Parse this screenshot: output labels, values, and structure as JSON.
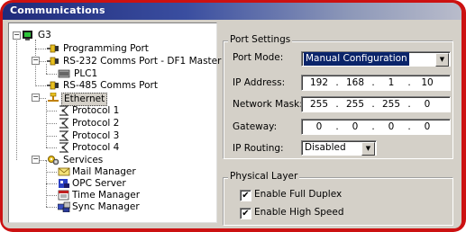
{
  "window": {
    "title": "Communications"
  },
  "tree": {
    "root": "G3",
    "items": [
      {
        "label": "Programming Port"
      },
      {
        "label": "RS-232 Comms Port - DF1 Master"
      },
      {
        "label": "PLC1"
      },
      {
        "label": "RS-485 Comms Port"
      },
      {
        "label": "Ethernet"
      },
      {
        "label": "Protocol 1"
      },
      {
        "label": "Protocol 2"
      },
      {
        "label": "Protocol 3"
      },
      {
        "label": "Protocol 4"
      },
      {
        "label": "Services"
      },
      {
        "label": "Mail Manager"
      },
      {
        "label": "OPC Server"
      },
      {
        "label": "Time Manager"
      },
      {
        "label": "Sync Manager"
      }
    ],
    "expand_minus": "−"
  },
  "port_settings": {
    "title": "Port Settings",
    "port_mode_label": "Port Mode:",
    "port_mode_value": "Manual Configuration",
    "ip_label": "IP Address:",
    "ip": [
      "192",
      "168",
      "1",
      "10"
    ],
    "mask_label": "Network Mask:",
    "mask": [
      "255",
      "255",
      "255",
      "0"
    ],
    "gateway_label": "Gateway:",
    "gateway": [
      "0",
      "0",
      "0",
      "0"
    ],
    "routing_label": "IP Routing:",
    "routing_value": "Disabled",
    "dot": "."
  },
  "physical_layer": {
    "title": "Physical Layer",
    "full_duplex_label": "Enable Full Duplex",
    "full_duplex_checked": true,
    "high_speed_label": "Enable High Speed",
    "high_speed_checked": true,
    "check_mark": "✔"
  },
  "colors": {
    "frame": "#cc1111",
    "titlebar": "#1f2a7a",
    "selection": "#0a246a"
  }
}
